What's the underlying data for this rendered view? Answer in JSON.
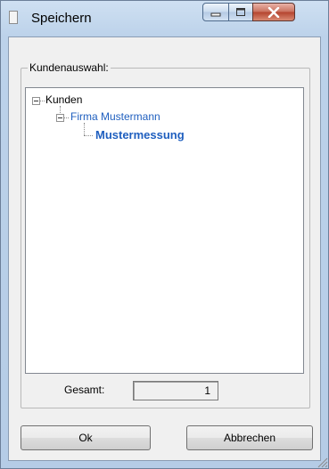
{
  "window": {
    "title": "Speichern",
    "controls": {
      "minimize": "minimize",
      "maximize": "maximize",
      "close": "close"
    }
  },
  "groupbox": {
    "label": "Kundenauswahl:"
  },
  "tree": {
    "root": {
      "label": "Kunden",
      "expanded": true
    },
    "child": {
      "label": "Firma Mustermann",
      "expanded": true,
      "color": "#1f5fbf"
    },
    "leaf": {
      "label": "Mustermessung",
      "bold": true,
      "color": "#1f5fbf"
    }
  },
  "status": {
    "label": "Gesamt:",
    "value": "1"
  },
  "buttons": {
    "ok": "Ok",
    "cancel": "Abbrechen"
  }
}
